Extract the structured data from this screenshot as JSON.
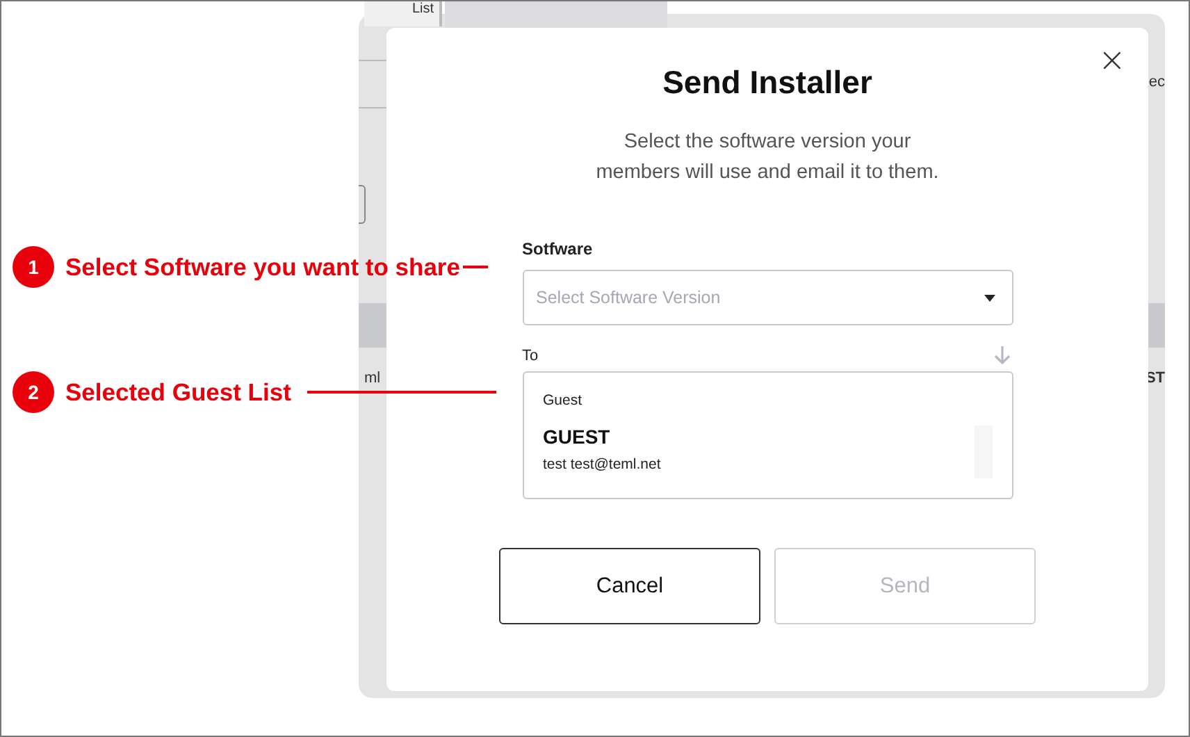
{
  "background": {
    "tab": "List",
    "fragments": [
      "ec",
      "ml",
      "ST"
    ]
  },
  "dialog": {
    "title": "Send Installer",
    "close": "×",
    "subtitle": "Select the software version your members will use and email it to them.",
    "software": {
      "label": "Sotfware",
      "placeholder": "Select Software Version"
    },
    "to": {
      "label": "To",
      "group": "Guest",
      "name": "GUEST",
      "detail": "test test@teml.net"
    },
    "buttons": [
      {
        "label": "Cancel",
        "disabled": false
      },
      {
        "label": "Send",
        "disabled": true
      }
    ]
  },
  "annotations": [
    {
      "number": "1",
      "text": "Select Software you want to share"
    },
    {
      "number": "2",
      "text": "Selected Guest List"
    }
  ]
}
